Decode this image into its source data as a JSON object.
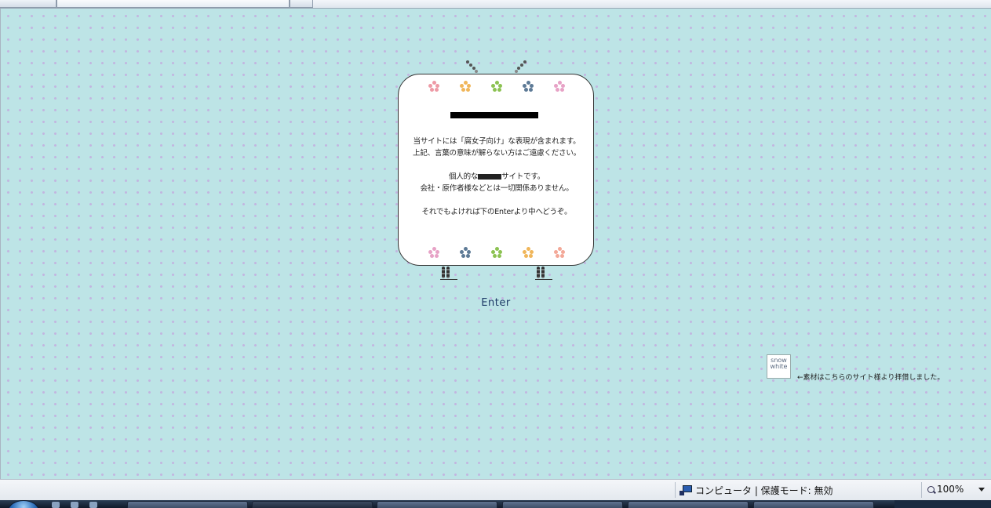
{
  "page": {
    "notice_lines": [
      "当サイトには「腐女子向け」な表現が含まれます。",
      "上記、言葉の意味が解らない方はご遠慮ください。"
    ],
    "personal_prefix": "個人的な",
    "personal_suffix": "サイトです。",
    "disclaimer": "会社・原作者様などとは一切関係ありません。",
    "proceed": "それでもよければ下のEnterより中へどうぞ。",
    "enter_label": "Enter",
    "banner_text_1": "snow",
    "banner_text_2": "white",
    "credit": "←素材はこちらのサイト様より拝借しました。"
  },
  "flowers": {
    "top": [
      "#ee9aa6",
      "#f0b65a",
      "#8cc252",
      "#5d7a96",
      "#e7a2c6"
    ],
    "bottom": [
      "#e7a2c6",
      "#5d7a96",
      "#8cc252",
      "#f0b65a",
      "#f3a898"
    ]
  },
  "status": {
    "zone": "コンピュータ | 保護モード: 無効",
    "zoom": "100%"
  }
}
